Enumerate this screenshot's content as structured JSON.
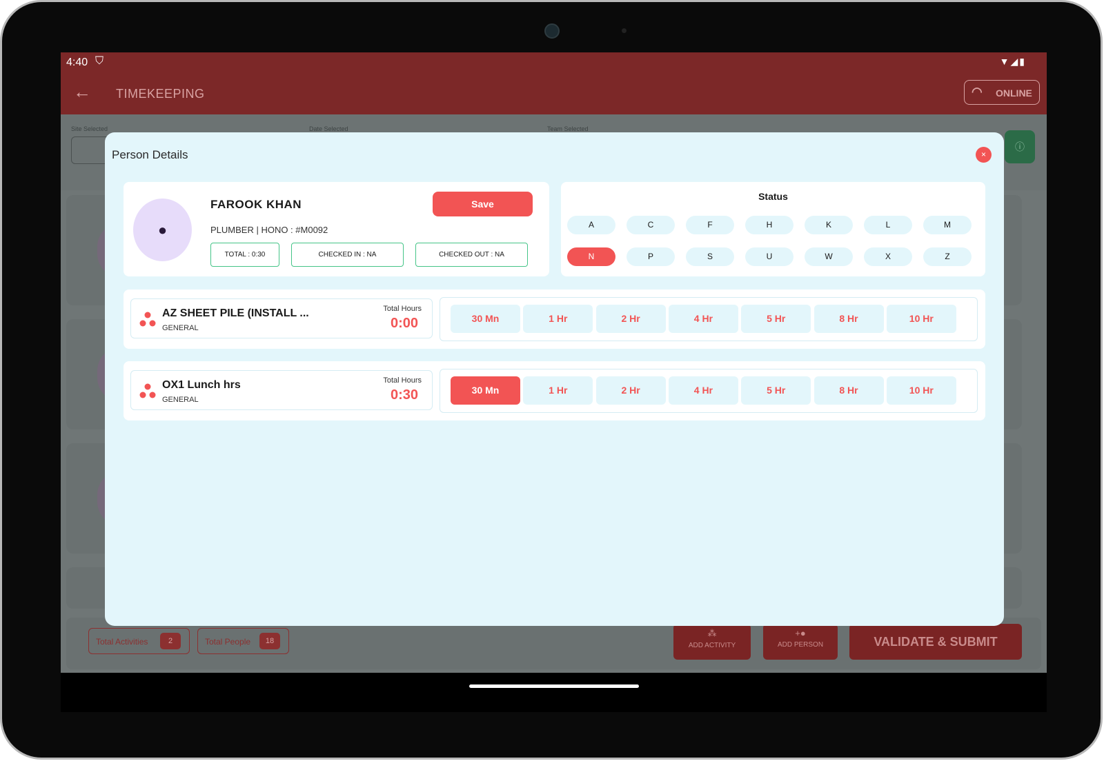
{
  "statusbar": {
    "time": "4:40"
  },
  "appbar": {
    "title": "TIMEKEEPING",
    "online_label": "ONLINE"
  },
  "filters": {
    "site_label": "Site Selected",
    "date_label": "Date Selected",
    "team_label": "Team Selected"
  },
  "bottom": {
    "total_activities_label": "Total Activities",
    "total_activities_count": "2",
    "total_people_label": "Total People",
    "total_people_count": "18",
    "add_activity": "ADD ACTIVITY",
    "add_person": "ADD PERSON",
    "validate": "VALIDATE & SUBMIT"
  },
  "modal": {
    "title": "Person Details",
    "close_glyph": "×",
    "person": {
      "name": "FAROOK KHAN",
      "subtitle": "PLUMBER | HONO : #M0092",
      "save": "Save",
      "total": "TOTAL : 0:30",
      "checked_in": "CHECKED IN : NA",
      "checked_out": "CHECKED OUT :  NA"
    },
    "status": {
      "title": "Status",
      "codes": [
        "A",
        "C",
        "F",
        "H",
        "K",
        "L",
        "M",
        "N",
        "P",
        "S",
        "U",
        "W",
        "X",
        "Z"
      ],
      "selected": "N"
    },
    "activities": [
      {
        "name": "AZ SHEET PILE (INSTALL ...",
        "category": "GENERAL",
        "total_label": "Total Hours",
        "total_value": "0:00",
        "selected": ""
      },
      {
        "name": "OX1 Lunch hrs",
        "category": "GENERAL",
        "total_label": "Total Hours",
        "total_value": "0:30",
        "selected": "30 Mn"
      }
    ],
    "durations": [
      "30 Mn",
      "1 Hr",
      "2 Hr",
      "4 Hr",
      "5 Hr",
      "8 Hr",
      "10 Hr"
    ]
  },
  "colors": {
    "accent": "#f25454",
    "appbar": "#7c2828",
    "modal_bg": "#e3f6fb",
    "green_border": "#44c487"
  }
}
